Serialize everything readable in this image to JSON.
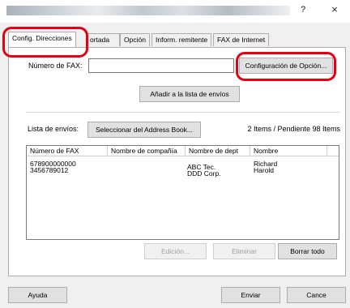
{
  "window": {
    "help_glyph": "?",
    "close_glyph": "×"
  },
  "tabs": [
    {
      "label": "Config. Direcciones",
      "active": true
    },
    {
      "label": "ortada"
    },
    {
      "label": "Opción"
    },
    {
      "label": "Inform. remitente"
    },
    {
      "label": "FAX de Internet"
    }
  ],
  "fax_number": {
    "label": "Número de FAX:",
    "value": ""
  },
  "buttons": {
    "option_config": "Configuración de Opción...",
    "add_to_list": "Añadir a la lista de envíos",
    "select_address_book": "Seleccionar del Address Book...",
    "edit": "Edición...",
    "delete": "Eliminar",
    "clear_all": "Borrar todo",
    "help": "Ayuda",
    "send": "Enviar",
    "cancel": "Cance"
  },
  "send_list": {
    "label": "Lista de envíos:",
    "status": "2 Items / Pendiente 98 Items",
    "columns": [
      "Número de FAX",
      "Nombre de compañía",
      "Nombre de dept",
      "Nombre"
    ],
    "rows": [
      [
        "678900000000",
        "",
        "ABC Tec.",
        "Richard"
      ],
      [
        "3456789012",
        "",
        "DDD Corp.",
        "Harold"
      ]
    ]
  },
  "colors": {
    "highlight_ring": "#e60012"
  }
}
